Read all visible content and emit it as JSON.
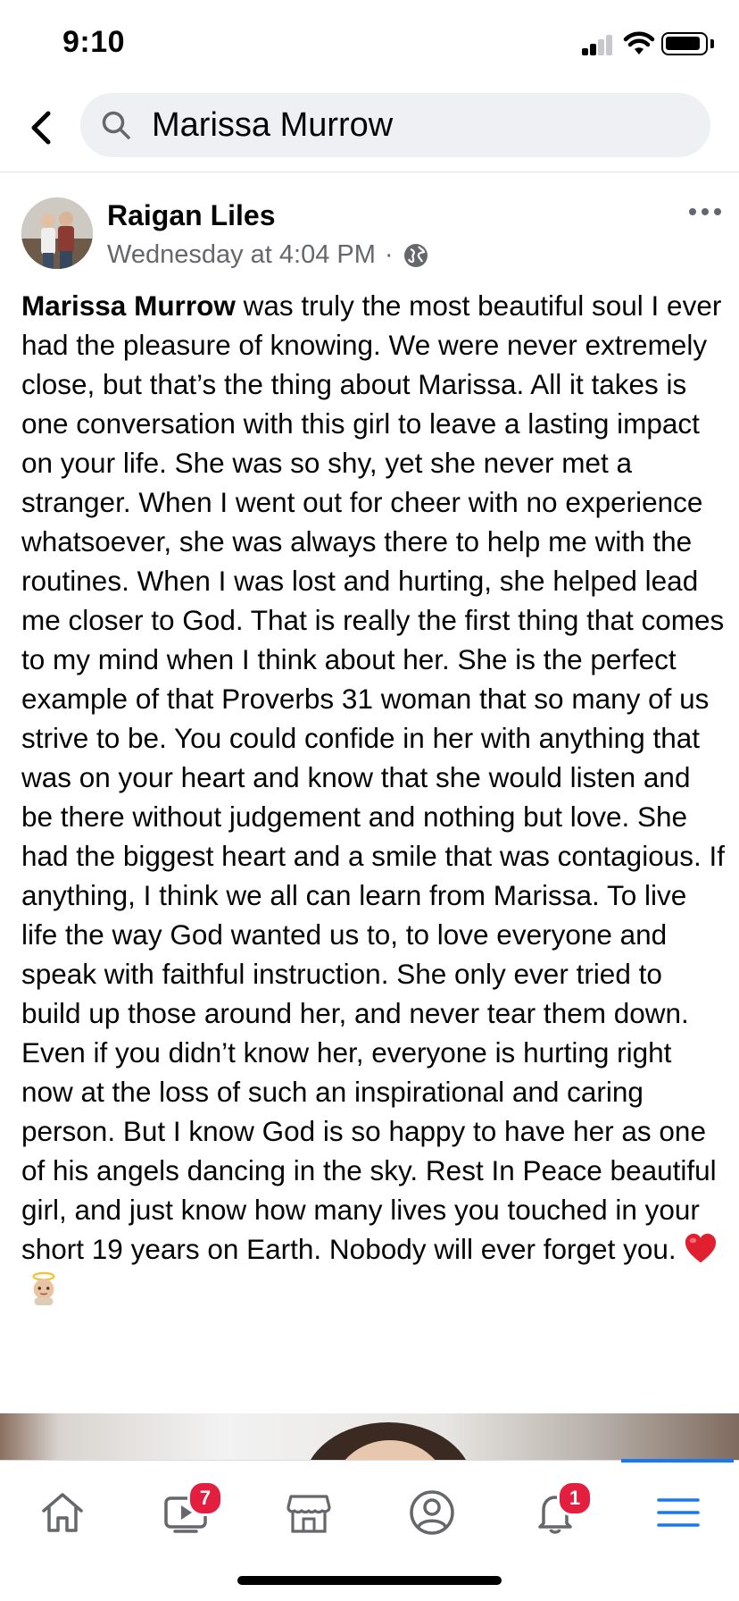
{
  "status_bar": {
    "time": "9:10",
    "icons": [
      "signal-icon",
      "wifi-icon",
      "battery-icon"
    ]
  },
  "search": {
    "query": "Marissa Murrow",
    "icons": [
      "back-chevron-icon",
      "search-icon"
    ]
  },
  "post": {
    "author": "Raigan Liles",
    "timestamp": "Wednesday at 4:04 PM",
    "separator": "·",
    "audience_icon": "globe-icon",
    "more_icon": "more-dots-icon",
    "mention": "Marissa Murrow",
    "body": " was truly the most beautiful soul I ever had the pleasure of knowing. We were never extremely close, but that’s the thing about Marissa. All it takes is one conversation with this girl to leave a lasting impact on your life. She was so shy, yet she never met a stranger. When I went out for cheer with no experience whatsoever, she was always there to help me with the routines. When I was lost and hurting, she helped lead me closer to God. That is really the first thing that comes to my mind when I think about her. She is the perfect example of that Proverbs 31 woman that so many of us strive to be. You could confide in her with anything that was on your heart and know that she would listen and be there without judgement and nothing but love. She had the biggest heart and a smile that was contagious. If anything, I think we all can learn from Marissa. To live life the way God wanted us to, to love everyone and speak with faithful instruction. She only ever tried to build up those around her, and never tear them down. Even if you didn’t know her, everyone is hurting right now at the loss of such an inspirational and caring person. But I know God is so happy to have her as one of his angels dancing in the sky. Rest In Peace beautiful girl, and just know how many lives you touched in your short 19 years on Earth. Nobody will ever forget you. ",
    "emojis": [
      "red-heart-emoji",
      "baby-angel-emoji"
    ]
  },
  "bottom_nav": {
    "items": [
      {
        "name": "home",
        "icon": "home-icon"
      },
      {
        "name": "watch",
        "icon": "video-icon",
        "badge": "7"
      },
      {
        "name": "marketplace",
        "icon": "shop-icon"
      },
      {
        "name": "profile",
        "icon": "profile-icon"
      },
      {
        "name": "notifications",
        "icon": "bell-icon",
        "badge": "1"
      },
      {
        "name": "menu",
        "icon": "menu-icon",
        "active": true
      }
    ],
    "accent_color": "#1877f2",
    "badge_color": "#e41e3f"
  }
}
